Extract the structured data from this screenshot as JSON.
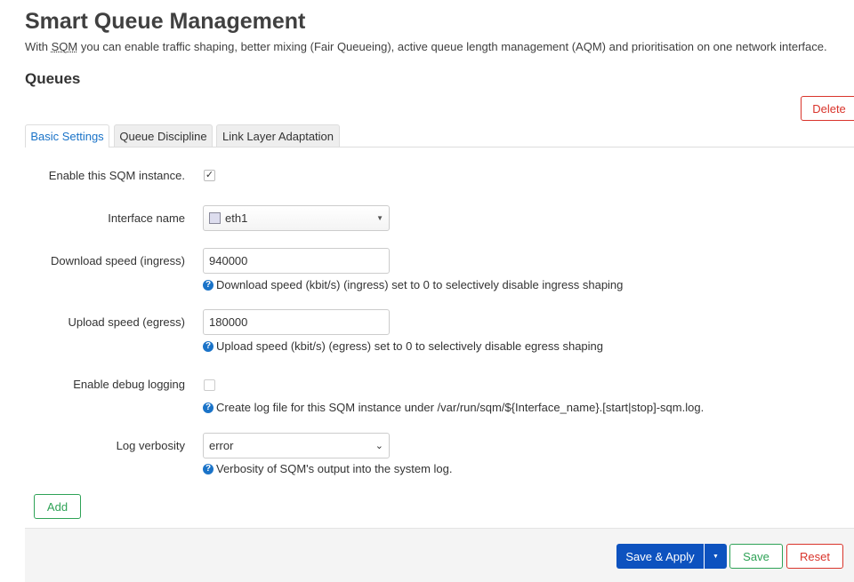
{
  "page": {
    "title": "Smart Queue Management",
    "description_prefix": "With ",
    "description_abbr": "SQM",
    "description_suffix": " you can enable traffic shaping, better mixing (Fair Queueing), active queue length management (AQM) and prioritisation on one network interface."
  },
  "section": {
    "title": "Queues",
    "delete_label": "Delete"
  },
  "tabs": [
    {
      "label": "Basic Settings",
      "active": true
    },
    {
      "label": "Queue Discipline"
    },
    {
      "label": "Link Layer Adaptation"
    }
  ],
  "form": {
    "enable": {
      "label": "Enable this SQM instance.",
      "checked": true,
      "mark": "✓"
    },
    "interface": {
      "label": "Interface name",
      "value": "eth1"
    },
    "download": {
      "label": "Download speed (ingress)",
      "value": "940000",
      "help": "Download speed (kbit/s) (ingress) set to 0 to selectively disable ingress shaping"
    },
    "upload": {
      "label": "Upload speed (egress)",
      "value": "180000",
      "help": "Upload speed (kbit/s) (egress) set to 0 to selectively disable egress shaping"
    },
    "debug": {
      "label": "Enable debug logging",
      "checked": false,
      "help": "Create log file for this SQM instance under /var/run/sqm/${Interface_name}.[start|stop]-sqm.log."
    },
    "verbosity": {
      "label": "Log verbosity",
      "value": "error",
      "help": "Verbosity of SQM's output into the system log."
    },
    "help_icon": "?"
  },
  "add_label": "Add",
  "footer": {
    "save_apply": "Save & Apply",
    "save": "Save",
    "reset": "Reset"
  },
  "colors": {
    "primary": "#0d52bf",
    "save": "#2ea256",
    "reset": "#d9342b",
    "link": "#1a73c8"
  }
}
